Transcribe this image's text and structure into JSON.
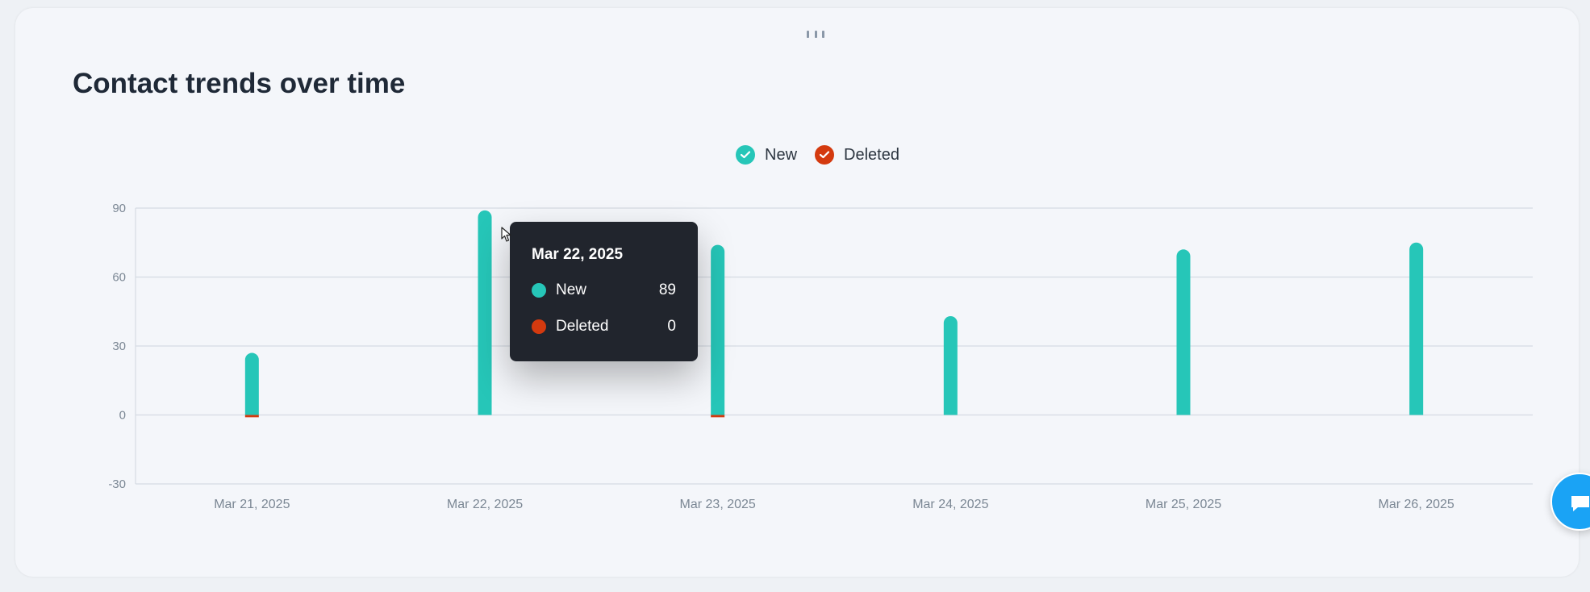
{
  "chart_data": {
    "type": "bar",
    "title": "Contact trends over time",
    "categories": [
      "Mar 21, 2025",
      "Mar 22, 2025",
      "Mar 23, 2025",
      "Mar 24, 2025",
      "Mar 25, 2025",
      "Mar 26, 2025"
    ],
    "series": [
      {
        "name": "New",
        "color": "#26c6b8",
        "values": [
          27,
          89,
          74,
          43,
          72,
          75
        ]
      },
      {
        "name": "Deleted",
        "color": "#d43a0f",
        "values": [
          -1,
          0,
          -1,
          0,
          0,
          0
        ]
      }
    ],
    "y_ticks": [
      90,
      60,
      30,
      0,
      -30
    ],
    "ylim": [
      -30,
      90
    ],
    "xlabel": "",
    "ylabel": "",
    "grid": true,
    "legend_position": "top-center"
  },
  "legend": {
    "new_label": "New",
    "deleted_label": "Deleted"
  },
  "tooltip": {
    "date": "Mar 22, 2025",
    "rows": [
      {
        "label": "New",
        "value": "89",
        "color": "#26c6b8"
      },
      {
        "label": "Deleted",
        "value": "0",
        "color": "#d43a0f"
      }
    ]
  },
  "icons": {
    "drag_handle": "drag-handle-icon",
    "legend_check": "check-icon",
    "chat": "chat-bubble-icon",
    "cursor": "mouse-pointer-icon"
  }
}
